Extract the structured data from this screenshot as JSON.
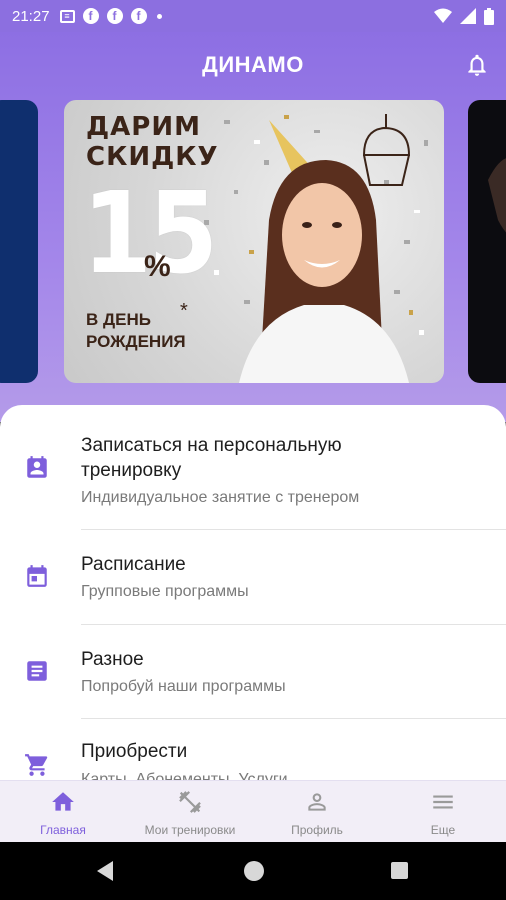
{
  "status_bar": {
    "time": "21:27",
    "icons": [
      "message-icon",
      "facebook-icon",
      "facebook-icon",
      "facebook-icon",
      "dot-icon"
    ],
    "right_icons": [
      "wifi-icon",
      "signal-icon",
      "battery-icon"
    ]
  },
  "app_bar": {
    "title": "ДИНАМО",
    "notification_icon": "bell-icon"
  },
  "banner": {
    "line1": "ДАРИМ",
    "line2": "СКИДКУ",
    "number": "15",
    "percent": "%",
    "footer1": "В ДЕНЬ",
    "footer2": "РОЖДЕНИЯ",
    "asterisk": "*"
  },
  "menu": [
    {
      "icon": "personal-training-icon",
      "title_line1": "Записаться на персональную",
      "title_line2": "тренировку",
      "subtitle": "Индивидуальное занятие с тренером"
    },
    {
      "icon": "calendar-icon",
      "title_line1": "Расписание",
      "subtitle": "Групповые программы"
    },
    {
      "icon": "article-icon",
      "title_line1": "Разное",
      "subtitle": "Попробуй наши программы"
    },
    {
      "icon": "cart-icon",
      "title_line1": "Приобрести",
      "subtitle": "Карты, Абонементы, Услуги"
    }
  ],
  "bottom_nav": [
    {
      "label": "Главная",
      "icon": "home-icon",
      "active": true
    },
    {
      "label": "Мои тренировки",
      "icon": "dumbbell-icon",
      "active": false
    },
    {
      "label": "Профиль",
      "icon": "person-icon",
      "active": false
    },
    {
      "label": "Еще",
      "icon": "menu-icon",
      "active": false
    }
  ],
  "colors": {
    "accent": "#7e5fdc",
    "header_top": "#8d6fe3",
    "header_bottom": "#b49be9",
    "icon_purple": "#7e5fdc"
  }
}
